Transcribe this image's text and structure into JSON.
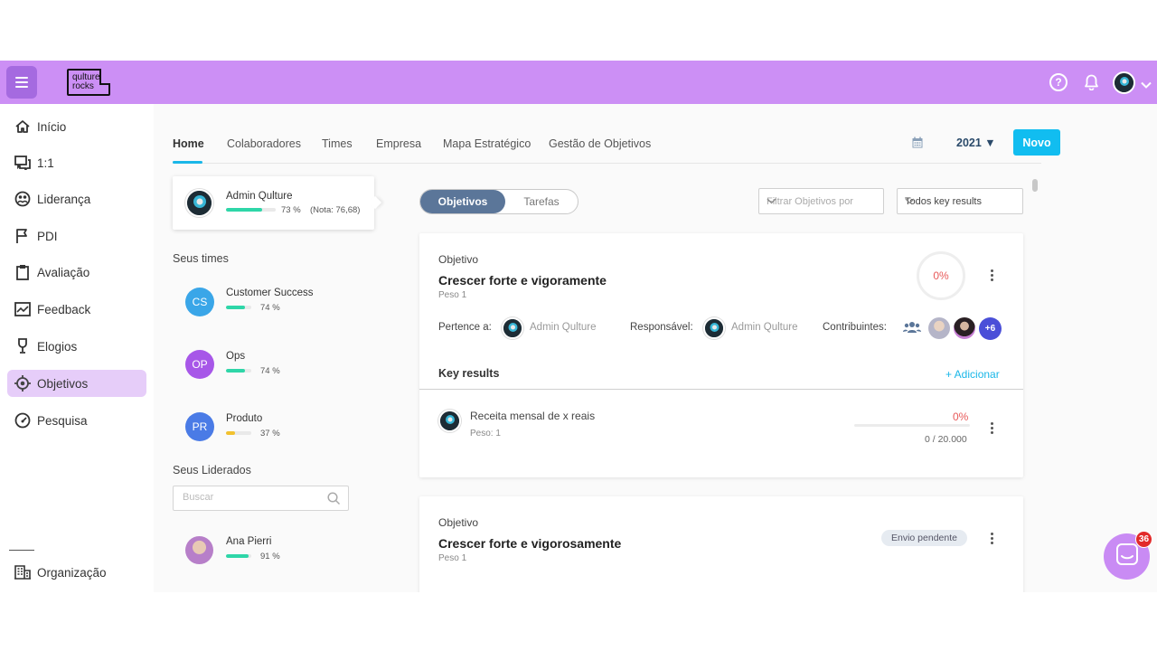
{
  "header": {
    "logo_line1": "qulture",
    "logo_line2": "rocks",
    "help_symbol": "?"
  },
  "sidebar": {
    "items": [
      {
        "label": "Início",
        "icon": "home-icon"
      },
      {
        "label": "1:1",
        "icon": "chat-bubbles-icon"
      },
      {
        "label": "Liderança",
        "icon": "leadership-icon"
      },
      {
        "label": "PDI",
        "icon": "flag-icon"
      },
      {
        "label": "Avaliação",
        "icon": "clipboard-icon"
      },
      {
        "label": "Feedback",
        "icon": "feedback-icon"
      },
      {
        "label": "Elogios",
        "icon": "trophy-icon"
      },
      {
        "label": "Objetivos",
        "icon": "target-icon"
      },
      {
        "label": "Pesquisa",
        "icon": "gauge-icon"
      }
    ],
    "active_index": 7,
    "footer_item": {
      "label": "Organização",
      "icon": "building-icon"
    }
  },
  "tabs": {
    "items": [
      "Home",
      "Colaboradores",
      "Times",
      "Empresa",
      "Mapa Estratégico",
      "Gestão de Objetivos"
    ],
    "active_index": 0,
    "year": "2021 ▼",
    "new_button": "Novo"
  },
  "user_card": {
    "name": "Admin Qulture",
    "percent": "73 %",
    "note": "(Nota: 76,68)",
    "progress": 0.73
  },
  "teams": {
    "title": "Seus times",
    "items": [
      {
        "initials": "CS",
        "name": "Customer Success",
        "percent": "74 %",
        "progress": 0.74,
        "color": "#3aa6e8"
      },
      {
        "initials": "OP",
        "name": "Ops",
        "percent": "74 %",
        "progress": 0.74,
        "color": "#a757e8"
      },
      {
        "initials": "PR",
        "name": "Produto",
        "percent": "37 %",
        "progress": 0.37,
        "color": "#4a7be6"
      }
    ]
  },
  "led": {
    "title": "Seus Liderados",
    "search_placeholder": "Buscar",
    "items": [
      {
        "name": "Ana Pierri",
        "percent": "91 %",
        "progress": 0.91
      }
    ]
  },
  "toggle": {
    "on": "Objetivos",
    "off": "Tarefas"
  },
  "filters": {
    "filter_by": "Filtrar Objetivos por",
    "key_results": "Todos key results"
  },
  "objectives": [
    {
      "kicker": "Objetivo",
      "title": "Crescer forte e vigoramente",
      "peso": "Peso 1",
      "percent": "0%",
      "belongs_label": "Pertence a:",
      "belongs_name": "Admin Qulture",
      "owner_label": "Responsável:",
      "owner_name": "Admin Qulture",
      "contrib_label": "Contribuintes:",
      "contrib_more": "+6",
      "kr_title": "Key results",
      "kr_add": "+ Adicionar",
      "kr": {
        "name": "Receita mensal de x reais",
        "peso": "Peso: 1",
        "percent": "0%",
        "value": "0  / 20.000",
        "progress": 0
      }
    },
    {
      "kicker": "Objetivo",
      "title": "Crescer forte e vigorosamente",
      "peso": "Peso 1",
      "badge": "Envio pendente"
    }
  ],
  "chat": {
    "count": "36"
  },
  "colors": {
    "brand": "#cc8ff5",
    "accent": "#11bdf0",
    "progress": "#2ed6a8",
    "danger": "#e85a5a"
  }
}
